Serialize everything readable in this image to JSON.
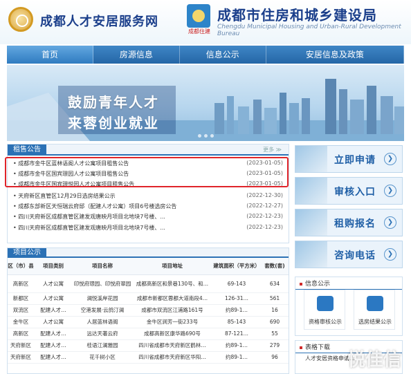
{
  "header": {
    "site_name": "成都人才安居服务网",
    "bureau_logo_text": "成都住建",
    "bureau_name": "成都市住房和城乡建设局",
    "bureau_name_en": "Chengdu Municipal Housing and Urban-Rural Development Bureau"
  },
  "nav": [
    {
      "label": "首页"
    },
    {
      "label": "房源信息"
    },
    {
      "label": "信息公示"
    },
    {
      "label": "安居信息及政策"
    }
  ],
  "banner": {
    "line1": "鼓励青年人才",
    "line2": "来蓉创业就业"
  },
  "notice": {
    "title": "租售公告",
    "more": "更多 ≫",
    "items": [
      {
        "title": "成都市金牛区蓝林语阁人才公寓项目租售公告",
        "date": "(2023-01-05)"
      },
      {
        "title": "成都市金牛区国宾璟园人才公寓项目租售公告",
        "date": "(2023-01-05)"
      },
      {
        "title": "成都市金牛区国宾璟悦园人才公寓项目租售公告",
        "date": "(2023-01-05)"
      },
      {
        "title": "天府新区直管区12月29日选房结果公示",
        "date": "(2022-12-30)"
      },
      {
        "title": "成都东部新区天恒瑞云府邸（配建人才公寓）项目6号楼选房公告",
        "date": "(2022-12-27)"
      },
      {
        "title": "四川天府新区成都直管区建发观唐映月项目北地块7号楼、...",
        "date": "(2022-12-23)"
      },
      {
        "title": "四川天府新区成都直管区建发观唐映月项目北地块7号楼、...",
        "date": "(2022-12-23)"
      }
    ]
  },
  "projects": {
    "title": "项目公示",
    "headers": [
      "区（市）县",
      "项目类别",
      "项目名称",
      "项目地址",
      "建筑面积（平方米）",
      "套数(套)"
    ],
    "rows": [
      [
        "高新区",
        "人才公寓",
        "印悦府璟园、印悦府翠园",
        "成都高新区和景巷130号、和…",
        "69-143",
        "634"
      ],
      [
        "新都区",
        "人才公寓",
        "澜悦溪岸花园",
        "成都市新都区蓉都大道南段4…",
        "126-31…",
        "561"
      ],
      [
        "双流区",
        "配建人才…",
        "空港发展·云鸽汀澜",
        "成都市双流区江浦路161号",
        "约89-1…",
        "16"
      ],
      [
        "金牛区",
        "人才公寓",
        "人居蓝林语阁",
        "金牛区涧芳一街233号",
        "85-143",
        "690"
      ],
      [
        "高新区",
        "配建人才…",
        "远达天著云府",
        "成都高新区康华路690号",
        "87-121…",
        "55"
      ],
      [
        "天府新区",
        "配建人才…",
        "桂语江澜雅园",
        "四川省成都市天府新区鹤林…",
        "约89-1…",
        "279"
      ],
      [
        "天府新区",
        "配建人才…",
        "花千树小区",
        "四川省成都市天府新区华阳…",
        "约89-1…",
        "96"
      ]
    ]
  },
  "side_buttons": [
    {
      "label": "立即申请",
      "icon": "arrow-right-icon"
    },
    {
      "label": "审核入口",
      "icon": "arrow-right-icon"
    },
    {
      "label": "租购报名",
      "icon": "arrow-right-icon"
    },
    {
      "label": "咨询电话",
      "icon": "arrow-right-icon"
    }
  ],
  "info_public": {
    "title": "信息公示",
    "items": [
      {
        "label": "资格审核公示",
        "icon": "id-card-icon"
      },
      {
        "label": "选房结果公示",
        "icon": "house-icon"
      }
    ]
  },
  "downloads": {
    "title": "表格下载",
    "item": "人才安居资格申请…"
  },
  "watermark": "悦佳信",
  "colors": {
    "primary": "#2b71b5",
    "highlight": "#e0242a",
    "title": "#1b3f8b"
  }
}
